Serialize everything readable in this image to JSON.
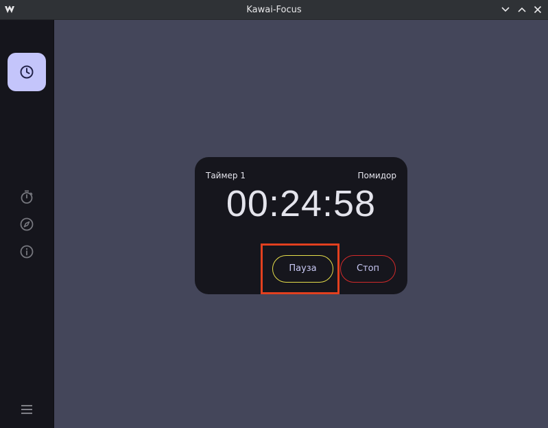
{
  "window": {
    "title": "Kawai-Focus",
    "controls": [
      "minimize-chevron-down-icon",
      "maximize-chevron-up-icon",
      "close-icon"
    ]
  },
  "sidebar": {
    "items": [
      {
        "icon": "clock-icon",
        "active": true
      },
      {
        "icon": "stopwatch-icon",
        "active": false
      },
      {
        "icon": "compass-icon",
        "active": false
      },
      {
        "icon": "info-icon",
        "active": false
      }
    ],
    "menu_icon": "hamburger-menu-icon"
  },
  "timer": {
    "name": "Таймер 1",
    "mode": "Помидор",
    "time": "00:24:58",
    "pause_label": "Пауза",
    "stop_label": "Стоп"
  },
  "colors": {
    "background": "#44465a",
    "sidebar": "#15151c",
    "card": "#16161d",
    "active_nav": "#c4c5fb",
    "pause_border": "#e8e04a",
    "stop_border": "#d62a2a",
    "highlight": "#e3401f"
  }
}
